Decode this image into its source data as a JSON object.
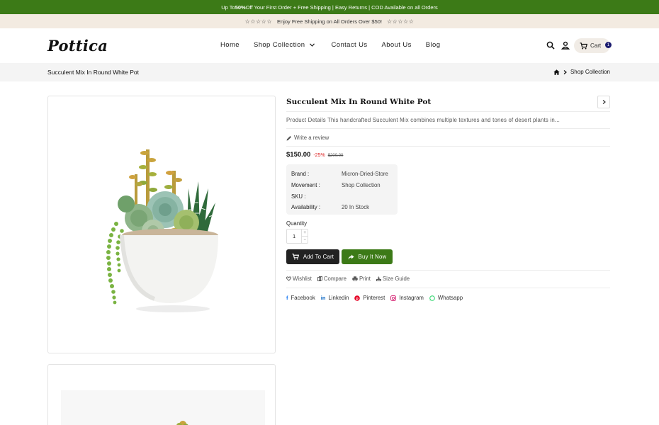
{
  "announcement": {
    "part1": "Up To ",
    "highlight": "50%",
    "part2": " Off Your First Order + Free Shipping | Easy Returns | COD Available on all Orders"
  },
  "subbar": {
    "stars": "☆☆☆☆☆",
    "text": "Enjoy Free Shipping on All Orders Over $50!"
  },
  "header": {
    "logo": "Pottica",
    "nav": [
      "Home",
      "Shop Collection",
      "Contact Us",
      "About Us",
      "Blog"
    ],
    "cart_label": "Cart",
    "cart_count": "1"
  },
  "breadcrumb": {
    "title": "Succulent Mix In Round White Pot",
    "trail": "Shop Collection"
  },
  "product": {
    "title": "Succulent Mix In Round White Pot",
    "description": "Product Details This handcrafted Succulent Mix combines multiple textures and tones of desert plants in...",
    "review_label": "Write a review",
    "price": "$150.00",
    "discount": "-25%",
    "old_price": "$200.00",
    "info": [
      {
        "key": "Brand :",
        "value": "Micron-Dried-Store"
      },
      {
        "key": "Movement :",
        "value": "Shop Collection"
      },
      {
        "key": "SKU :",
        "value": ""
      },
      {
        "key": "Availability :",
        "value": "20 In Stock"
      }
    ],
    "quantity_label": "Quantity",
    "quantity_value": "1",
    "add_to_cart": "Add To Cart",
    "buy_now": "Buy It Now",
    "actions": [
      "Wishlist",
      "Compare",
      "Print",
      "Size Guide"
    ],
    "social": [
      "Facebook",
      "Linkedin",
      "Pinterest",
      "Instagram",
      "Whatsapp"
    ]
  },
  "colors": {
    "brand_green": "#3c7a17",
    "dark": "#222222",
    "discount_red": "#dd2222",
    "cart_badge": "#1a1a6e"
  }
}
